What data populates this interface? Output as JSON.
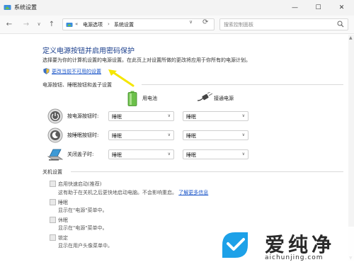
{
  "window": {
    "title": "系统设置",
    "minimize": "—",
    "maximize": "☐",
    "close": "✕"
  },
  "nav": {
    "back": "←",
    "forward": "→",
    "history": "∨",
    "up": "↑",
    "breadcrumb_prefix": "«",
    "breadcrumb": [
      "电源选项",
      "系统设置"
    ],
    "breadcrumb_sep": "›",
    "address_dropdown": "∨",
    "refresh": "⟳",
    "search_placeholder": "搜索控制面板"
  },
  "page": {
    "title": "定义电源按钮并启用密码保护",
    "description": "选择要为你的计算机设置的电源设置。在此页上对设置所做的更改将应用于你所有的电源计划。",
    "change_link": "更改当前不可用的设置"
  },
  "power_section": {
    "title": "电源按钮、睡眠按钮和盖子设置",
    "col_battery": "用电池",
    "col_plugged": "接通电源",
    "rows": [
      {
        "label": "按电源按钮时:",
        "battery": "睡眠",
        "plugged": "睡眠",
        "icon": "power-button-icon"
      },
      {
        "label": "按睡眠按钮时:",
        "battery": "睡眠",
        "plugged": "睡眠",
        "icon": "sleep-button-icon"
      },
      {
        "label": "关闭盖子时:",
        "battery": "睡眠",
        "plugged": "睡眠",
        "icon": "laptop-lid-icon"
      }
    ],
    "dropdown_arrow": "∨"
  },
  "shutdown_section": {
    "title": "关机设置",
    "items": [
      {
        "label": "启用快速启动(推荐)",
        "desc": "这有助于在关机之后更快地启动电脑。不会影响重启。",
        "link": "了解更多信息"
      },
      {
        "label": "睡眠",
        "desc": "显示在\"电源\"菜单中。"
      },
      {
        "label": "休眠",
        "desc": "显示在\"电源\"菜单中。"
      },
      {
        "label": "锁定",
        "desc": "显示在用户头像菜单中。"
      }
    ]
  },
  "scrollbar": {
    "up": "▲",
    "down": "▼"
  },
  "watermark": {
    "name": "爱纯净",
    "url": "aichunjing.com"
  },
  "colors": {
    "title_blue": "#1a3e8c",
    "link_blue": "#1a55c8",
    "annotation_yellow": "#f5e600",
    "battery_green": "#6cc04a"
  }
}
